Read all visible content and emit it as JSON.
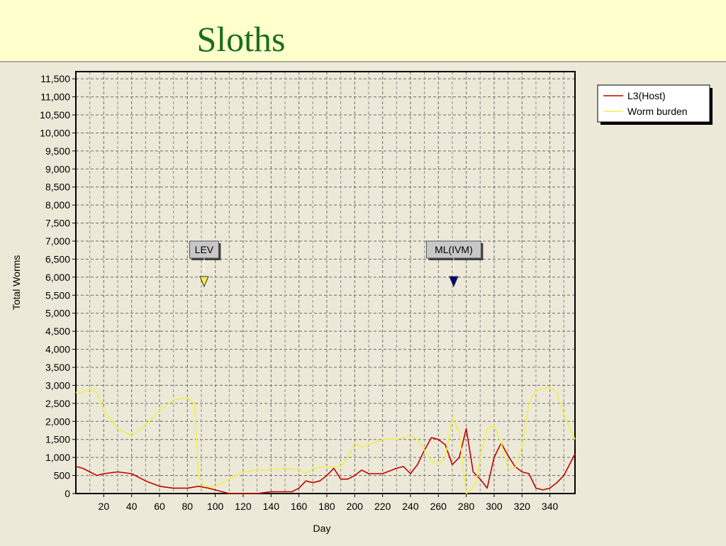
{
  "page": {
    "title": "Sloths",
    "title_color": "#1a6e1a",
    "background": "#ffffcc"
  },
  "chart_data": {
    "type": "line",
    "title": "",
    "xlabel": "Day",
    "ylabel": "Total Worms",
    "xlim": [
      0,
      358
    ],
    "ylim": [
      0,
      11700
    ],
    "x_ticks": [
      20,
      40,
      60,
      80,
      100,
      120,
      140,
      160,
      180,
      200,
      220,
      240,
      260,
      280,
      300,
      320,
      340
    ],
    "y_ticks": [
      0,
      500,
      1000,
      1500,
      2000,
      2500,
      3000,
      3500,
      4000,
      4500,
      5000,
      5500,
      6000,
      6500,
      7000,
      7500,
      8000,
      8500,
      9000,
      9500,
      10000,
      10500,
      11000,
      11500
    ],
    "grid": true,
    "legend_position": "top-right",
    "series": [
      {
        "name": "L3(Host)",
        "color": "#c00000",
        "x": [
          0,
          5,
          10,
          15,
          20,
          30,
          40,
          50,
          60,
          70,
          80,
          88,
          95,
          100,
          105,
          110,
          120,
          130,
          140,
          150,
          155,
          160,
          165,
          170,
          175,
          180,
          185,
          190,
          195,
          200,
          205,
          210,
          220,
          230,
          235,
          240,
          245,
          250,
          255,
          260,
          265,
          270,
          275,
          280,
          285,
          290,
          295,
          300,
          305,
          310,
          315,
          320,
          325,
          330,
          335,
          340,
          345,
          350,
          358
        ],
        "values": [
          750,
          700,
          600,
          500,
          550,
          600,
          550,
          350,
          200,
          150,
          150,
          200,
          150,
          100,
          50,
          0,
          0,
          0,
          50,
          50,
          50,
          150,
          350,
          300,
          350,
          500,
          700,
          400,
          400,
          500,
          650,
          550,
          550,
          700,
          750,
          550,
          800,
          1200,
          1550,
          1500,
          1350,
          800,
          1000,
          1800,
          600,
          400,
          150,
          1000,
          1400,
          1050,
          750,
          600,
          550,
          150,
          100,
          150,
          300,
          500,
          1100
        ]
      },
      {
        "name": "Worm burden",
        "color": "#f0f050",
        "x": [
          0,
          5,
          10,
          15,
          20,
          30,
          40,
          50,
          60,
          70,
          80,
          85,
          88,
          92,
          95,
          100,
          110,
          120,
          130,
          140,
          150,
          160,
          165,
          170,
          180,
          190,
          195,
          200,
          205,
          210,
          220,
          230,
          240,
          245,
          250,
          255,
          260,
          265,
          270,
          275,
          280,
          283,
          287,
          290,
          295,
          300,
          305,
          310,
          315,
          320,
          325,
          330,
          335,
          340,
          345,
          350,
          358
        ],
        "values": [
          2800,
          2800,
          2900,
          2800,
          2300,
          1800,
          1600,
          1900,
          2300,
          2600,
          2650,
          2500,
          500,
          200,
          200,
          200,
          400,
          600,
          650,
          650,
          700,
          650,
          550,
          700,
          750,
          750,
          1000,
          1400,
          1300,
          1350,
          1500,
          1500,
          1600,
          1500,
          1200,
          900,
          800,
          1000,
          2100,
          1700,
          0,
          100,
          300,
          1000,
          1800,
          1900,
          1400,
          700,
          700,
          1300,
          2500,
          2850,
          2900,
          2950,
          2800,
          2200,
          1500
        ]
      }
    ],
    "annotations": [
      {
        "label": "LEV",
        "x": 92,
        "marker_color": "#f0f050"
      },
      {
        "label": "ML(IVM)",
        "x": 271,
        "marker_color": "#000080"
      }
    ]
  }
}
